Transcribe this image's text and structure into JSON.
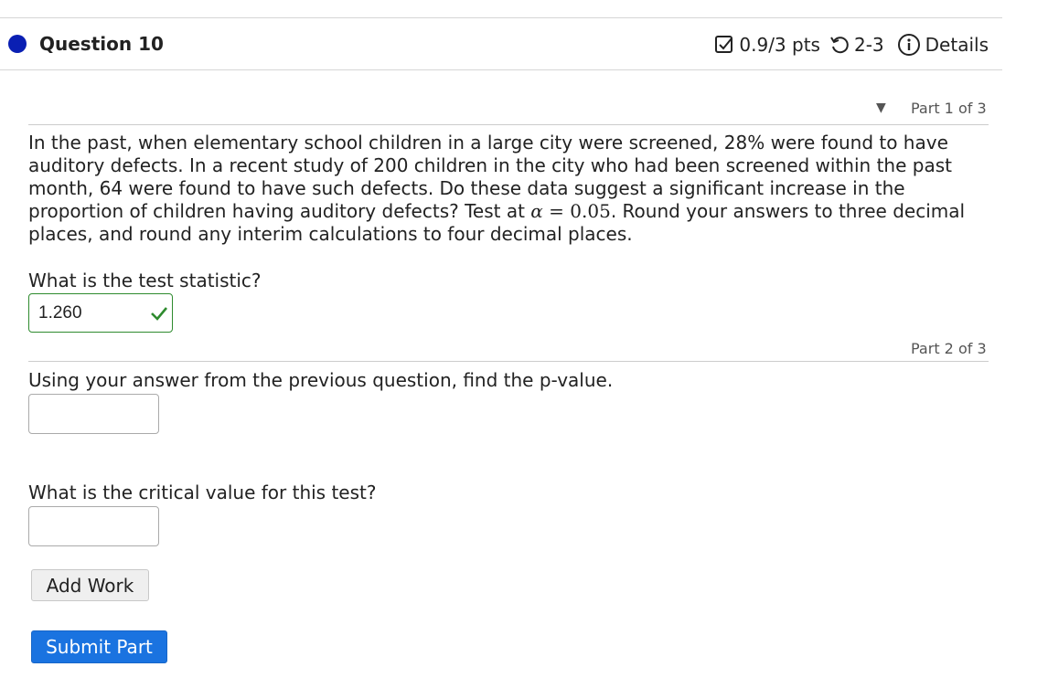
{
  "header": {
    "question_title": "Question 10",
    "points": "0.9/3 pts",
    "attempts": "2-3",
    "details_label": "Details"
  },
  "part1": {
    "label": "Part 1 of 3",
    "question_before_alpha": "In the past, when elementary school children in a large city were screened, 28% were found to have auditory defects. In a recent study of 200 children in the city who had been screened within the past month, 64 were found to have such defects. Do these data suggest a significant increase in the proportion of children having auditory defects? Test at ",
    "alpha_symbol": "α",
    "equals": " = ",
    "alpha_value": "0.05",
    "question_after_alpha": ". Round your answers to three decimal places, and round any interim calculations to four decimal places.",
    "prompt": "What is the test statistic?",
    "answer_value": "1.260"
  },
  "part2": {
    "label": "Part 2 of 3",
    "prompt_pvalue": "Using your answer from the previous question, find the p-value.",
    "pvalue_value": "",
    "prompt_critical": "What is the critical value for this test?",
    "critical_value": ""
  },
  "buttons": {
    "add_work": "Add Work",
    "submit_part": "Submit Part"
  },
  "icons": {
    "status_dot": "filled-circle",
    "points": "checkbox-icon",
    "attempts": "retry-icon",
    "details": "info-icon",
    "correct": "check-icon",
    "collapse": "triangle-down-icon"
  },
  "colors": {
    "status_dot": "#0a1fb3",
    "correct_border": "#2e8b2e",
    "submit_button": "#1a73e0"
  }
}
